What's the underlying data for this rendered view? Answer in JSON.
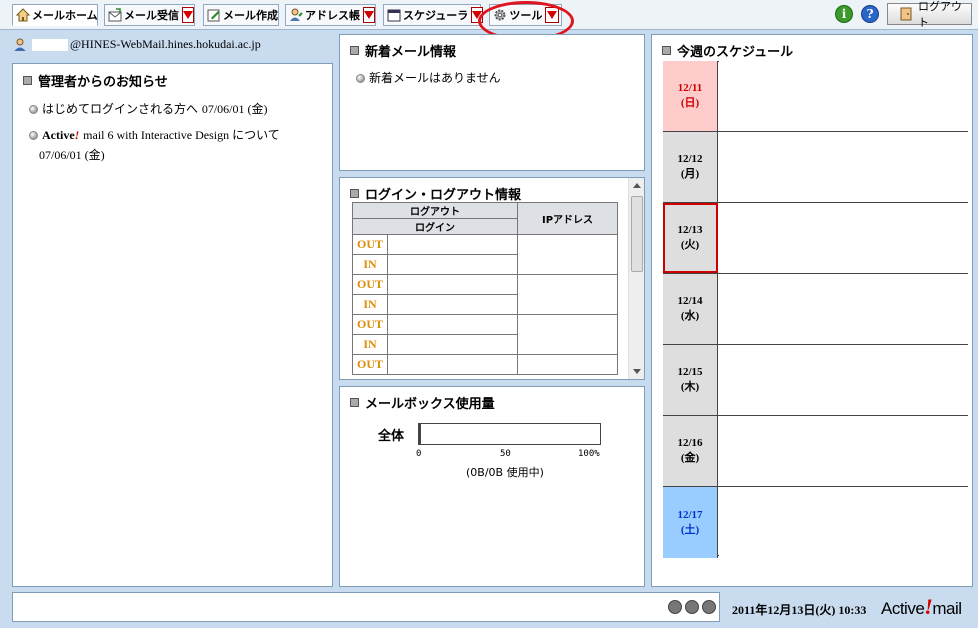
{
  "toolbar": {
    "tabs": [
      {
        "label": "メールホーム",
        "icon": "home-icon"
      },
      {
        "label": "メール受信",
        "icon": "mail-receive-icon"
      },
      {
        "label": "メール作成",
        "icon": "mail-compose-icon"
      },
      {
        "label": "アドレス帳",
        "icon": "address-book-icon"
      },
      {
        "label": "スケジューラ",
        "icon": "scheduler-icon"
      },
      {
        "label": "ツール",
        "icon": "gear-icon"
      }
    ],
    "logout_label": "ログアウト",
    "highlight_color": "#e0141e"
  },
  "user": {
    "address_suffix": "@HINES-WebMail.hines.hokudai.ac.jp"
  },
  "notices": {
    "title": "管理者からのお知らせ",
    "items": [
      {
        "text": "はじめてログインされる方へ",
        "date": "07/06/01 (金)"
      },
      {
        "brand": "Active",
        "brand_mark": "!",
        "text": "mail 6 with Interactive Design について",
        "date": "07/06/01 (金)"
      }
    ]
  },
  "new_mail": {
    "title": "新着メール情報",
    "message": "新着メールはありません"
  },
  "login_info": {
    "title": "ログイン・ログアウト情報",
    "col_logout": "ログアウト",
    "col_login": "ログイン",
    "col_ip": "IPアドレス",
    "rows": [
      "OUT",
      "IN",
      "OUT",
      "IN",
      "OUT",
      "IN",
      "OUT"
    ]
  },
  "mailbox": {
    "title": "メールボックス使用量",
    "label": "全体",
    "usage_percent": 0,
    "scale": [
      "0",
      "50",
      "100%"
    ],
    "usage_text": "(0B/0B 使用中)"
  },
  "schedule": {
    "title": "今週のスケジュール",
    "days": [
      {
        "date": "12/11",
        "dow": "(日)",
        "color": "#cc0000",
        "bg": "#ffcccc"
      },
      {
        "date": "12/12",
        "dow": "(月)",
        "color": "#000000",
        "bg": "#dedede"
      },
      {
        "date": "12/13",
        "dow": "(火)",
        "color": "#000000",
        "bg": "#dedede",
        "today": true
      },
      {
        "date": "12/14",
        "dow": "(水)",
        "color": "#000000",
        "bg": "#dedede"
      },
      {
        "date": "12/15",
        "dow": "(木)",
        "color": "#000000",
        "bg": "#dedede"
      },
      {
        "date": "12/16",
        "dow": "(金)",
        "color": "#000000",
        "bg": "#dedede"
      },
      {
        "date": "12/17",
        "dow": "(土)",
        "color": "#0033cc",
        "bg": "#99ccff"
      }
    ]
  },
  "status": {
    "datetime": "2011年12月13日(火) 10:33",
    "brand_prefix": "Active",
    "brand_mark": "!",
    "brand_suffix": "mail"
  }
}
